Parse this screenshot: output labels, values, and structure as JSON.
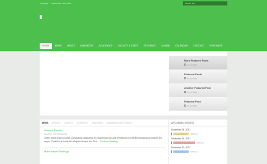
{
  "topbar": {
    "items": [
      "Thursday",
      "December 10th, 2015"
    ],
    "search_placeholder": "search site"
  },
  "nav": {
    "items": [
      "Home",
      "News",
      "About",
      "Handbook",
      "Academics",
      "Faculty & Staff",
      "Students",
      "Alumni",
      "Calendar",
      "Contact",
      "Purchase"
    ]
  },
  "featured": {
    "items": [
      {
        "title": "More Featured Posts",
        "date": "10.10.2009"
      },
      {
        "title": "Featured Posts",
        "date": "10.10.2009"
      },
      {
        "title": "Another Featured Post",
        "date": "10.10.2009"
      },
      {
        "title": "Featured Post",
        "date": "10.10.2009"
      }
    ]
  },
  "tabs": [
    "News",
    "Events",
    "Guests",
    "Students",
    "Features",
    "Hardware/Software"
  ],
  "posts": [
    {
      "title": "Student Events",
      "meta": "by admin / No Comments",
      "excerpt": "Lorem ipsum dolor sit amet, consectetur adipiscing elit. Maecenas non odio fermentum leo eleifend adipiscing sit amet sed neque. Curabitur at tortor dui, aliquam tempus leo. Sed ...",
      "read_more": "Continue Reading"
    },
    {
      "title": "More News Postings",
      "meta": "",
      "excerpt": "",
      "read_more": ""
    }
  ],
  "sidebar": {
    "title": "Upcoming Events",
    "events": [
      {
        "date": "December 28, 2021",
        "badge": "General Event",
        "badge_color": "#f3e08a",
        "time": "4:00 pm"
      },
      {
        "date": "December 30, 2021",
        "badge": "Faculty & Staff Event",
        "badge_color": "#f2a6a6",
        "time": "4:00 pm"
      },
      {
        "date": "December 31, 2021",
        "badge": "Student Event",
        "badge_color": "#a9d0f5",
        "time": "4:00 pm"
      }
    ]
  },
  "colors": {
    "brand": "#4cbf4c",
    "background": "#e9ebe9"
  }
}
